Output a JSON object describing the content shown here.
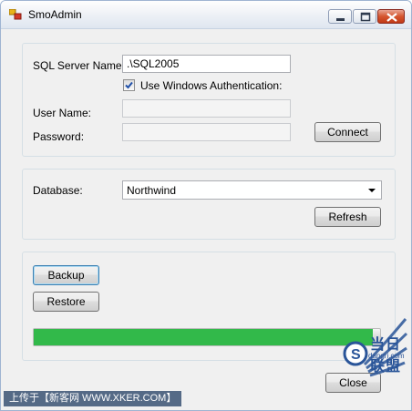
{
  "window": {
    "title": "SmoAdmin"
  },
  "connection": {
    "server_label": "SQL Server Name:",
    "server_value": ".\\SQL2005",
    "windows_auth_label": "Use Windows Authentication:",
    "windows_auth_checked": true,
    "username_label": "User Name:",
    "username_value": "",
    "password_label": "Password:",
    "password_value": "",
    "connect_label": "Connect"
  },
  "database": {
    "label": "Database:",
    "selected": "Northwind",
    "refresh_label": "Refresh"
  },
  "operations": {
    "backup_label": "Backup",
    "restore_label": "Restore",
    "progress": 0.98,
    "close_label": "Close"
  },
  "watermark": {
    "bar_text": "上传于【新客网 WWW.XKER.COM】",
    "brand_text": "当日联盟",
    "brand_sub": "dangri.com"
  },
  "colors": {
    "progress_fill": "#32b94a",
    "close_button": "#c13a16",
    "watermark_bar": "#556a86"
  }
}
